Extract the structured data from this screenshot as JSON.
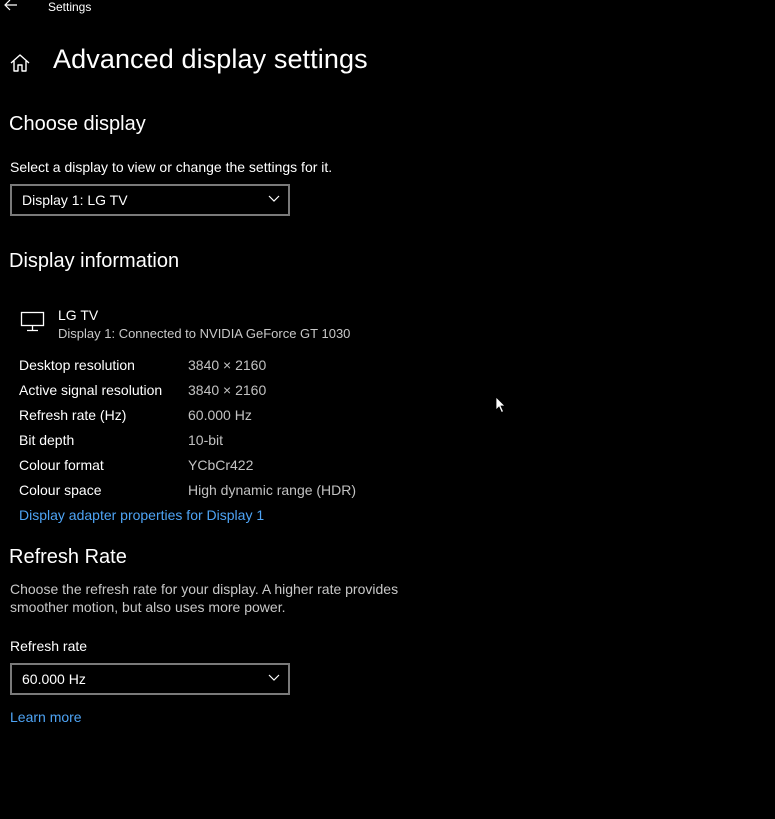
{
  "window": {
    "app_title": "Settings"
  },
  "header": {
    "title": "Advanced display settings"
  },
  "choose_display": {
    "heading": "Choose display",
    "prompt": "Select a display to view or change the settings for it.",
    "selected": "Display 1: LG TV"
  },
  "display_info": {
    "heading": "Display information",
    "monitor_name": "LG TV",
    "monitor_sub": "Display 1: Connected to NVIDIA GeForce GT 1030",
    "rows": [
      {
        "label": "Desktop resolution",
        "value": "3840 × 2160"
      },
      {
        "label": "Active signal resolution",
        "value": "3840 × 2160"
      },
      {
        "label": "Refresh rate (Hz)",
        "value": "60.000 Hz"
      },
      {
        "label": "Bit depth",
        "value": "10-bit"
      },
      {
        "label": "Colour format",
        "value": "YCbCr422"
      },
      {
        "label": "Colour space",
        "value": "High dynamic range (HDR)"
      }
    ],
    "adapter_link": "Display adapter properties for Display 1"
  },
  "refresh": {
    "heading": "Refresh Rate",
    "desc_line1": "Choose the refresh rate for your display. A higher rate provides",
    "desc_line2": "smoother motion, but also uses more power.",
    "label": "Refresh rate",
    "selected": "60.000 Hz",
    "learn_more": "Learn more"
  },
  "colors": {
    "background": "#000000",
    "text": "#ffffff",
    "muted": "#c2c2c2",
    "link": "#4ea4f5",
    "border": "#7a7a7a"
  },
  "icons": [
    "back-arrow-icon",
    "home-icon",
    "chevron-down-icon",
    "monitor-icon",
    "mouse-cursor-icon"
  ]
}
